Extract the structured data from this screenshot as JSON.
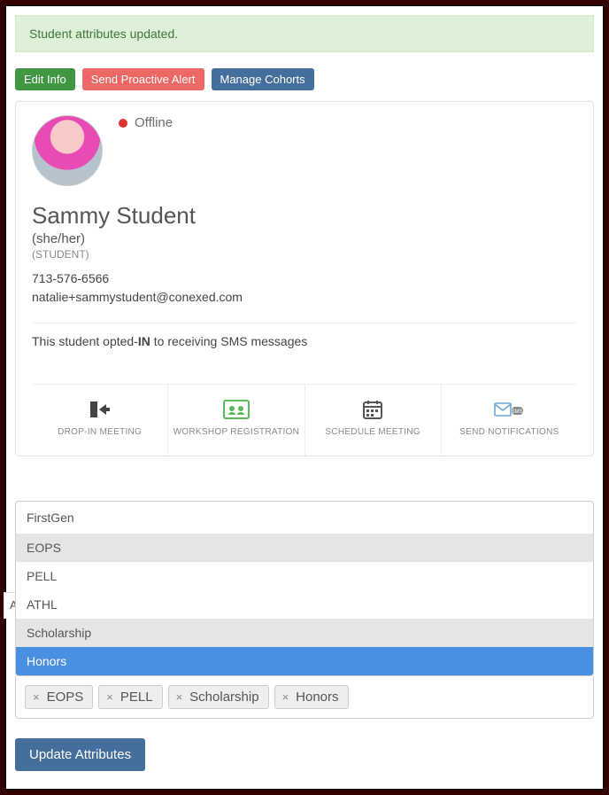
{
  "alert": "Student attributes updated.",
  "buttons": {
    "edit": "Edit Info",
    "alert": "Send Proactive Alert",
    "cohorts": "Manage Cohorts"
  },
  "status": "Offline",
  "student": {
    "name": "Sammy Student",
    "pronouns": "(she/her)",
    "role": "(STUDENT)",
    "phone": "713-576-6566",
    "email": "natalie+sammystudent@conexed.com"
  },
  "optin_pre": "This student opted-",
  "optin_bold": "IN",
  "optin_post": " to receiving SMS messages",
  "actions": [
    {
      "label": "DROP-IN MEETING"
    },
    {
      "label": "WORKSHOP REGISTRATION"
    },
    {
      "label": "SCHEDULE MEETING"
    },
    {
      "label": "SEND NOTIFICATIONS"
    }
  ],
  "dropdown": {
    "input": "FirstGen",
    "items": [
      "EOPS",
      "PELL",
      "ATHL",
      "Scholarship",
      "Honors"
    ]
  },
  "tab_peek": "A",
  "tags": [
    "EOPS",
    "PELL",
    "Scholarship",
    "Honors"
  ],
  "update": "Update Attributes"
}
